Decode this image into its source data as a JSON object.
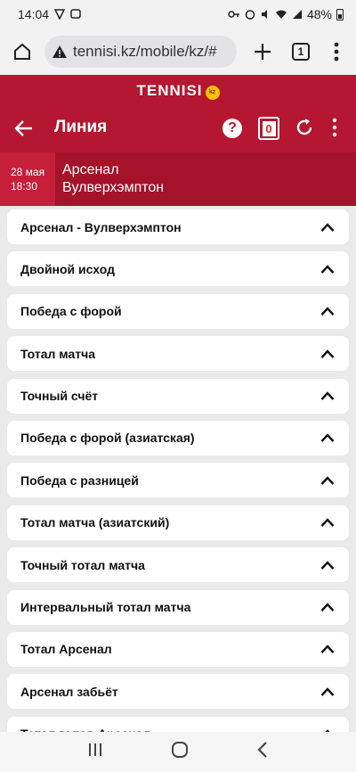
{
  "status_bar": {
    "time": "14:04",
    "battery": "48%"
  },
  "browser": {
    "url": "tennisi.kz/mobile/kz/#",
    "tab_count": "1"
  },
  "app": {
    "brand": "TENNISI",
    "brand_badge": "kz",
    "title": "Линия",
    "help_label": "?",
    "coupon_count": "0"
  },
  "match": {
    "date": "28 мая",
    "time": "18:30",
    "team1": "Арсенал",
    "team2": "Вулверхэмптон"
  },
  "markets": [
    "Арсенал - Вулверхэмптон",
    "Двойной исход",
    "Победа с форой",
    "Тотал матча",
    "Точный счёт",
    "Победа с форой (азиатская)",
    "Победа с разницей",
    "Тотал матча (азиатский)",
    "Точный тотал матча",
    "Интервальный тотал матча",
    "Тотал Арсенал",
    "Арсенал забьёт",
    "Тотал голов Арсенал"
  ],
  "colors": {
    "brand_red": "#b4172f",
    "badge_yellow": "#f5c400"
  }
}
